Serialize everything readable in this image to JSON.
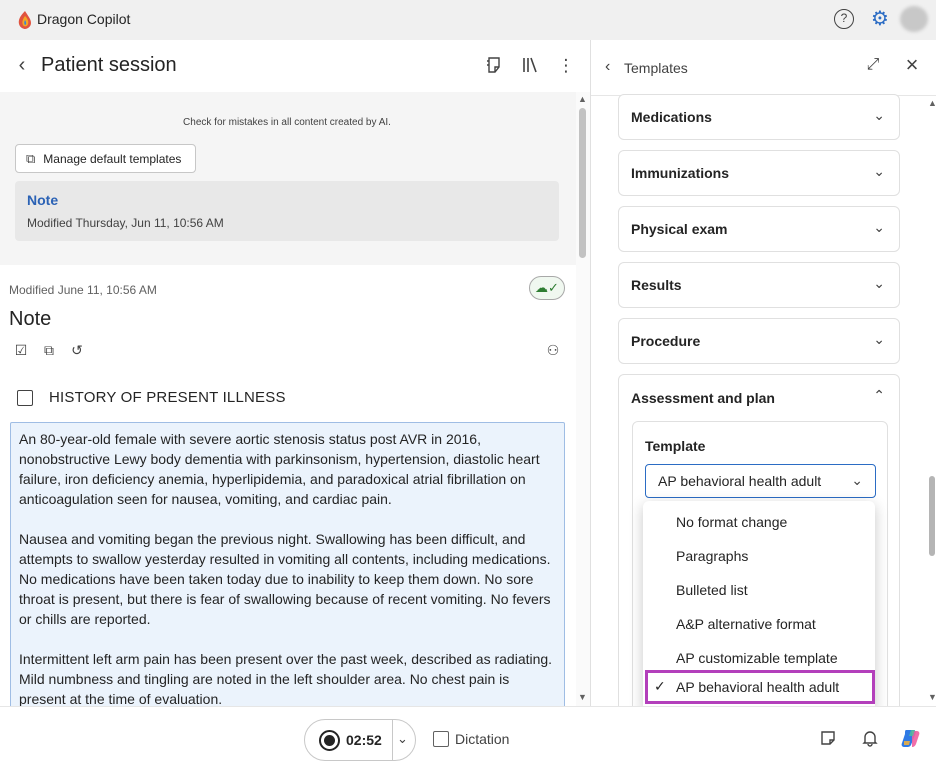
{
  "app": {
    "title": "Dragon Copilot",
    "help_glyph": "?",
    "settings_icon": "gear-icon",
    "brand_color": "#2b6cc4"
  },
  "left": {
    "header_title": "Patient session",
    "ai_warning": "Check for mistakes in all content created by AI.",
    "manage_button": "Manage default templates",
    "note_card": {
      "title": "Note",
      "modified": "Modified Thursday, Jun 11, 10:56 AM"
    },
    "modified_line": "Modified June 11, 10:56 AM",
    "note_heading": "Note",
    "section_title": "HISTORY OF PRESENT ILLNESS",
    "hpi_paragraphs": [
      "An 80-year-old female with severe aortic stenosis status post AVR in 2016, nonobstructive Lewy body dementia with parkinsonism, hypertension, diastolic heart failure, iron deficiency anemia, hyperlipidemia, and paradoxical atrial fibrillation on anticoagulation seen for nausea, vomiting, and cardiac pain.",
      "Nausea and vomiting began the previous night. Swallowing has been difficult, and attempts to swallow yesterday resulted in vomiting all contents, including medications. No medications have been taken today due to inability to keep them down. No sore throat is present, but there is fear of swallowing because of recent vomiting. No fevers or chills are reported.",
      "Intermittent left arm pain has been present over the past week, described as radiating. Mild numbness and tingling are noted in the left shoulder area. No chest pain is present at the time of evaluation."
    ]
  },
  "bottom": {
    "timer": "02:52",
    "dictation_label": "Dictation"
  },
  "right": {
    "title": "Templates",
    "sections": [
      "Medications",
      "Immunizations",
      "Physical exam",
      "Results",
      "Procedure"
    ],
    "expanded_section": "Assessment and plan",
    "template_label": "Template",
    "selected_template": "AP behavioral health adult",
    "options": [
      "No format change",
      "Paragraphs",
      "Bulleted list",
      "A&P alternative format",
      "AP customizable template",
      "AP behavioral health adult"
    ],
    "highlight_color": "#b33fbb"
  }
}
